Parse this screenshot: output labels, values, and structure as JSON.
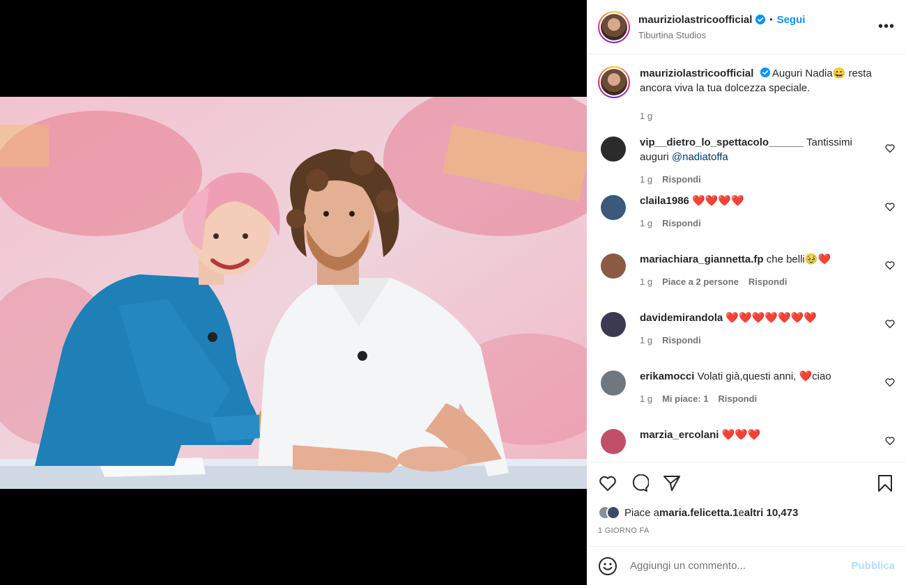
{
  "post": {
    "username": "mauriziolastricoofficial",
    "follow_label": "Segui",
    "separator": "•",
    "location": "Tiburtina Studios",
    "more_icon": "more-horizontal-icon",
    "more_label": "•••"
  },
  "caption": {
    "username": "mauriziolastricoofficial",
    "text": "Auguri Nadia😄 resta ancora viva la tua dolcezza speciale.",
    "time": "1 g"
  },
  "comments": [
    {
      "username": "vip__dietro_lo_spettacolo______",
      "text_before": "Tantissimi auguri ",
      "mention": "@nadiatoffa",
      "time": "1 g",
      "likes": "",
      "reply": "Rispondi",
      "avatar_color": "#2b2b2b"
    },
    {
      "username": "claila1986",
      "text_before": "❤️❤️❤️❤️",
      "mention": "",
      "time": "1 g",
      "likes": "",
      "reply": "Rispondi",
      "avatar_color": "#3b5a7a"
    },
    {
      "username": "mariachiara_giannetta.fp",
      "text_before": "che belli🥹❤️",
      "mention": "",
      "time": "1 g",
      "likes": "Piace a 2 persone",
      "reply": "Rispondi",
      "avatar_color": "#8a5a44"
    },
    {
      "username": "davidemirandola",
      "text_before": "❤️❤️❤️❤️❤️❤️❤️",
      "mention": "",
      "time": "1 g",
      "likes": "",
      "reply": "Rispondi",
      "avatar_color": "#3c3a52"
    },
    {
      "username": "erikamocci",
      "text_before": "Volati già,questi anni, ❤️ciao",
      "mention": "",
      "time": "1 g",
      "likes": "Mi piace: 1",
      "reply": "Rispondi",
      "avatar_color": "#6f7780"
    },
    {
      "username": "marzia_ercolani",
      "text_before": "❤️❤️❤️",
      "mention": "",
      "time": "",
      "likes": "",
      "reply": "",
      "avatar_color": "#c24e6a"
    }
  ],
  "likes": {
    "prefix": "Piace a ",
    "user": "maria.felicetta.1",
    "middle": " e ",
    "others": "altri 10,473"
  },
  "date": "1 GIORNO FA",
  "add_comment": {
    "placeholder": "Aggiungi un commento...",
    "publish_label": "Pubblica"
  },
  "colors": {
    "accent": "#0095f6",
    "publish_disabled": "#b2dffc",
    "verified": "#0095f6"
  }
}
